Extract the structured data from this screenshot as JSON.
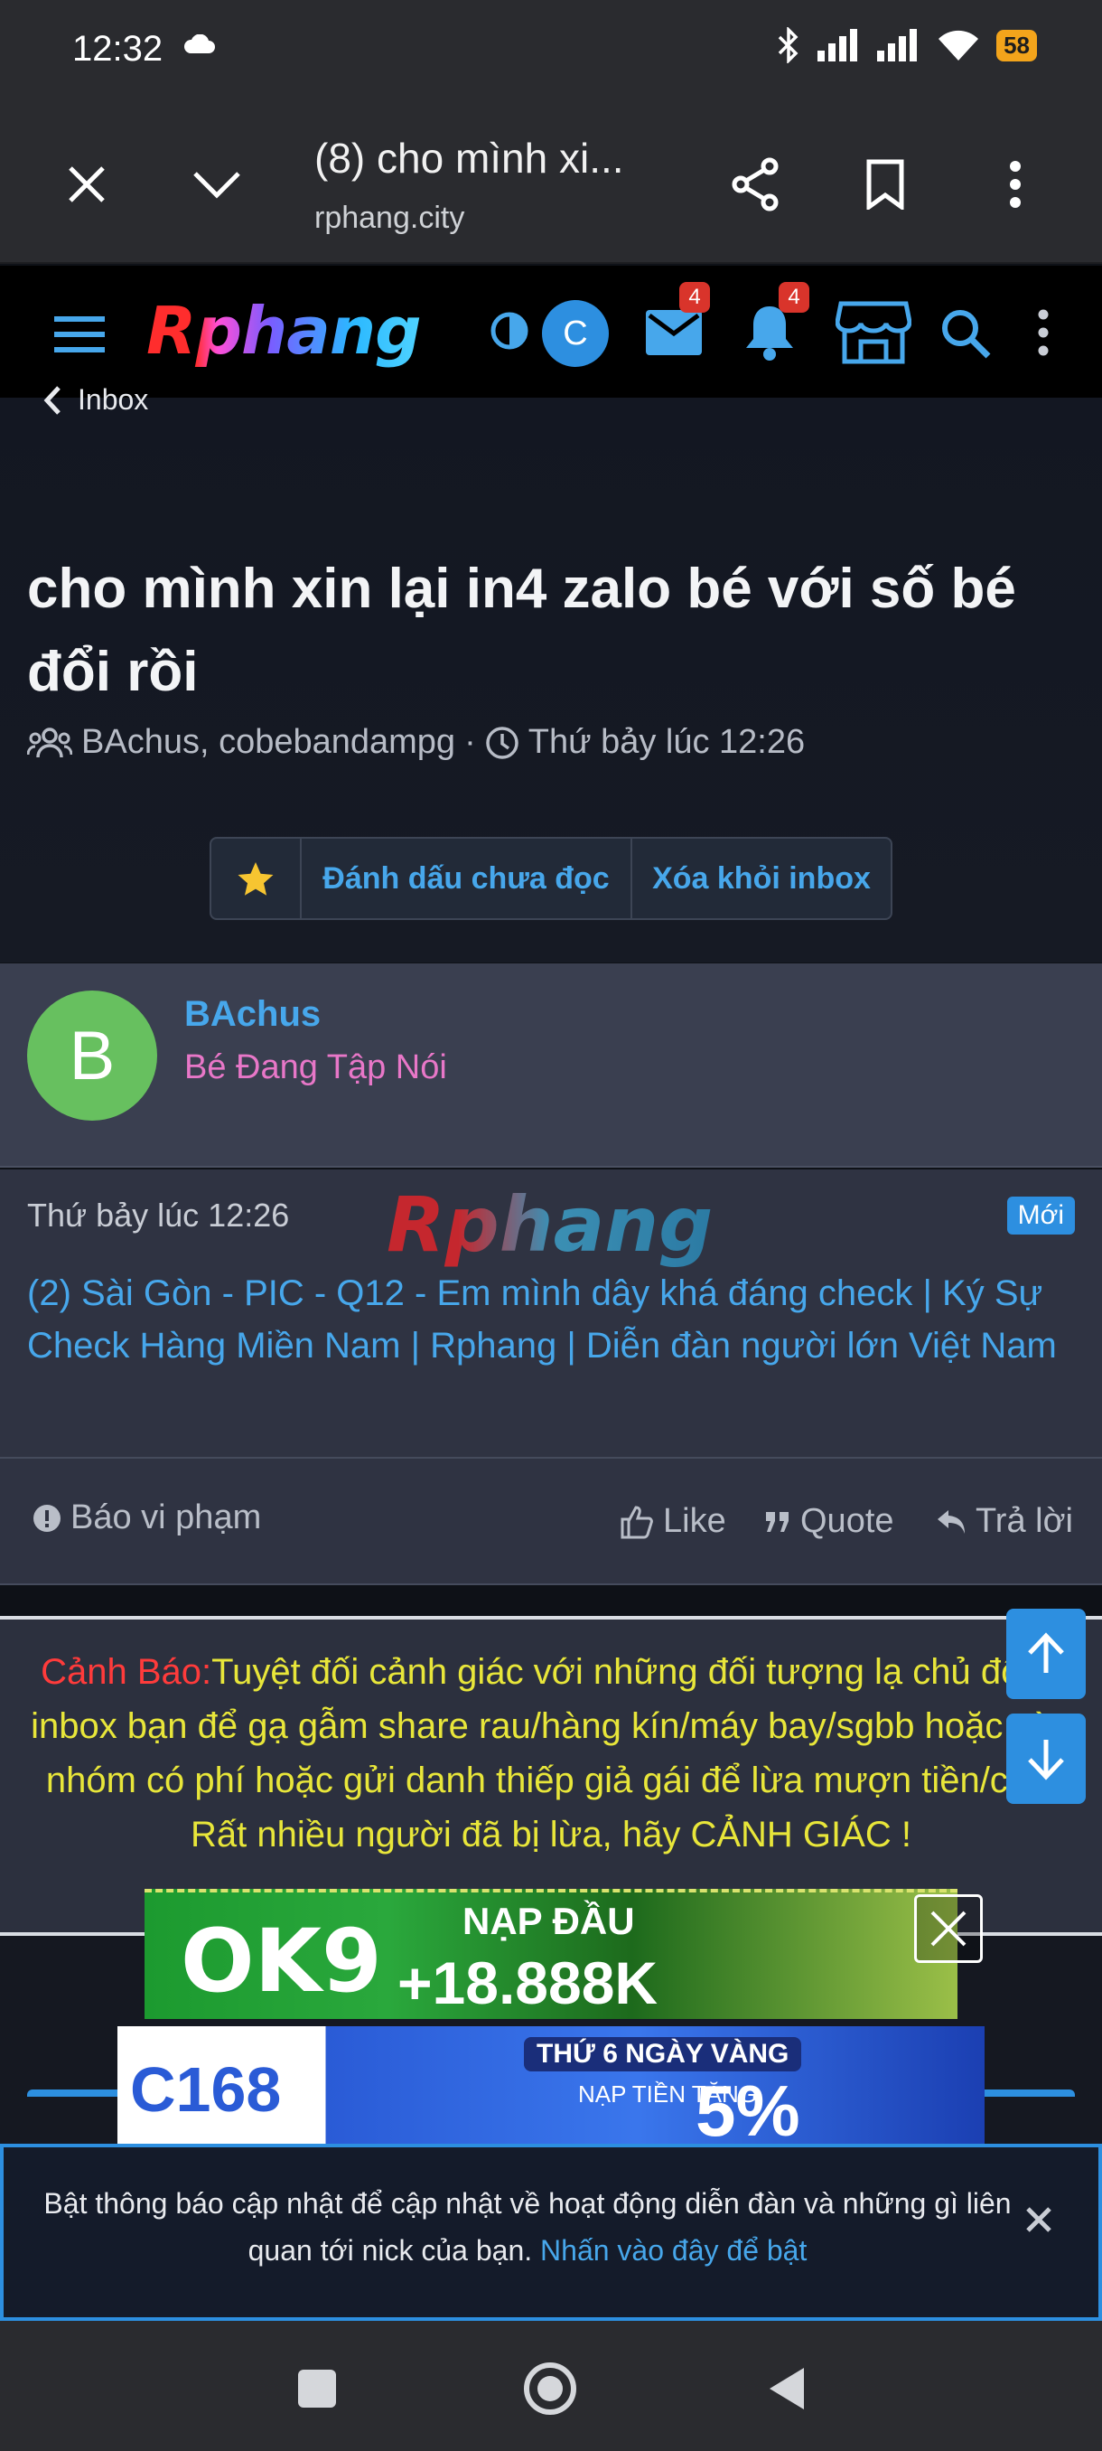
{
  "status_bar": {
    "time": "12:32",
    "battery": "58"
  },
  "browser": {
    "page_title": "(8) cho mình xi...",
    "url": "rphang.city"
  },
  "site": {
    "logo_text": "Rphang",
    "avatar_letter": "C",
    "inbox_count": "4",
    "alerts_count": "4"
  },
  "breadcrumb": {
    "label": "Inbox"
  },
  "thread": {
    "title": "cho mình xin lại in4 zalo bé với số bé đổi rồi",
    "participants": "BAchus, cobebandampg",
    "separator": "·",
    "date": "Thứ bảy lúc 12:26",
    "buttons": {
      "mark_unread": "Đánh dấu chưa đọc",
      "remove": "Xóa khỏi inbox"
    }
  },
  "author": {
    "initial": "B",
    "name": "BAchus",
    "user_title": "Bé Đang Tập Nói"
  },
  "message": {
    "date": "Thứ bảy lúc 12:26",
    "watermark": "Rphang",
    "badge": "Mới",
    "link_text": "(2) Sài Gòn - PIC - Q12 - Em mình dây khá đáng check | Ký Sự Check Hàng Miền Nam | Rphang | Diễn đàn người lớn Việt Nam"
  },
  "actions": {
    "report": "Báo vi phạm",
    "like": "Like",
    "quote": "Quote",
    "reply": "Trả lời"
  },
  "warning": {
    "prefix": "Cảnh Báo:",
    "text": "Tuyệt đối cảnh giác với những đối tượng lạ chủ động inbox bạn để gạ gẫm share rau/hàng kín/máy bay/sgbb hoặc vào nhóm có phí hoặc gửi danh thiếp giả gái để lừa mượn tiền/cọc.",
    "text2": "Rất nhiều người đã bị lừa, hãy CẢNH GIÁC !"
  },
  "ads": {
    "ad1": {
      "logo": "OK9",
      "line1": "NẠP ĐẦU",
      "line2": "+18.888K"
    },
    "ad2": {
      "logo": "C168",
      "line1": "THỨ 6 NGÀY VÀNG",
      "line2": "NẠP TIỀN TẶNG",
      "line3": "5%"
    }
  },
  "notice": {
    "text": "Bật thông báo cập nhật để cập nhật về hoạt động diễn đàn và những gì liên quan tới nick của bạn.",
    "link": "Nhấn vào đây để bật"
  },
  "colors": {
    "accent": "#47a7eb",
    "user_title": "#e877c8",
    "warning": "#e8e63a",
    "warning_prefix": "#ff3b3b"
  }
}
